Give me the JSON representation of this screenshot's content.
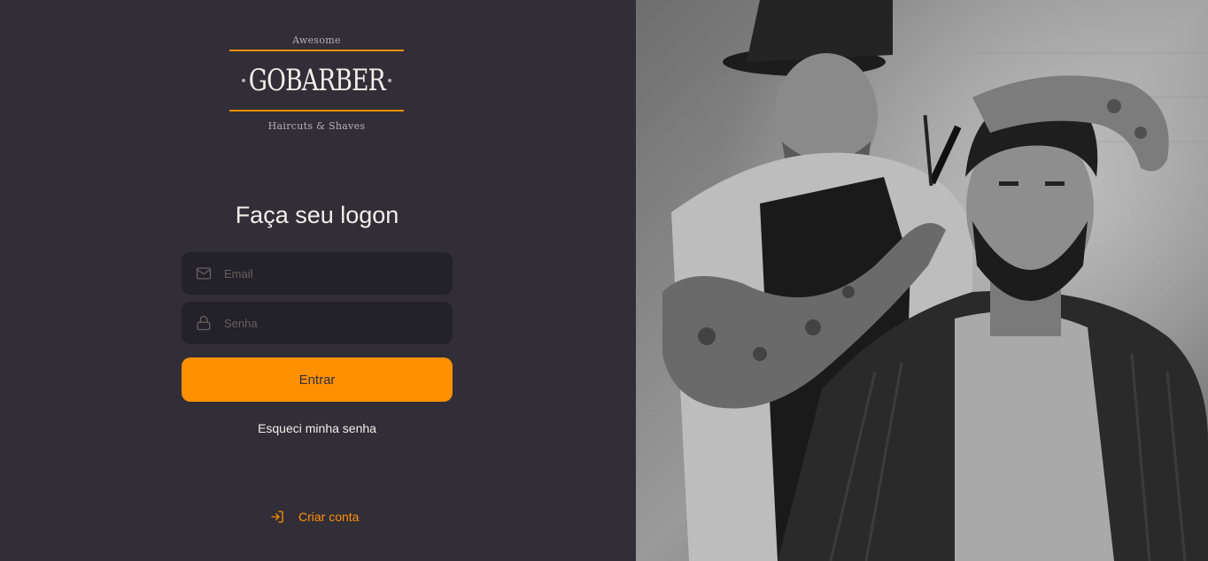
{
  "logo": {
    "tag_top": "Awesome",
    "brand": "GOBARBER",
    "tag_bottom": "Haircuts & Shaves"
  },
  "form": {
    "title": "Faça seu logon",
    "email_placeholder": "Email",
    "password_placeholder": "Senha",
    "submit_label": "Entrar",
    "forgot_label": "Esqueci minha senha"
  },
  "footer": {
    "create_account_label": "Criar conta"
  },
  "icons": {
    "email": "mail-icon",
    "password": "lock-icon",
    "create": "log-in-icon"
  },
  "colors": {
    "background": "#312e38",
    "input_background": "#232129",
    "accent": "#ff9000",
    "text": "#f4ede8",
    "placeholder": "#666360"
  }
}
